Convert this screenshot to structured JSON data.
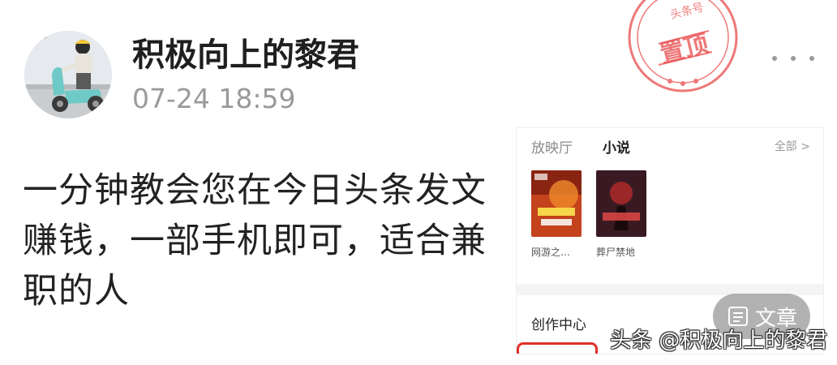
{
  "author": {
    "name": "积极向上的黎君",
    "post_time": "07-24 18:59",
    "avatar_icon": "avatar-person-on-scooter"
  },
  "pinned_stamp": {
    "top_text": "头条号",
    "label": "置顶",
    "color": "#e94b4b"
  },
  "more": {
    "icon": "more-dots-icon"
  },
  "post": {
    "text": "一分钟教会您在今日头条发文赚钱，一部手机即可，适合兼职的人"
  },
  "thumbnail": {
    "tabs": [
      "放映厅",
      "小说"
    ],
    "all_label": "全部 >",
    "books": [
      {
        "title": "网游之…",
        "cover_color": "#c4421c"
      },
      {
        "title": "葬尸禁地",
        "cover_color": "#3a1a22"
      }
    ],
    "section_title": "创作中心"
  },
  "article_badge": {
    "label": "文章",
    "icon": "article-icon"
  },
  "watermark": {
    "text": "头条 @积极向上的黎君"
  }
}
